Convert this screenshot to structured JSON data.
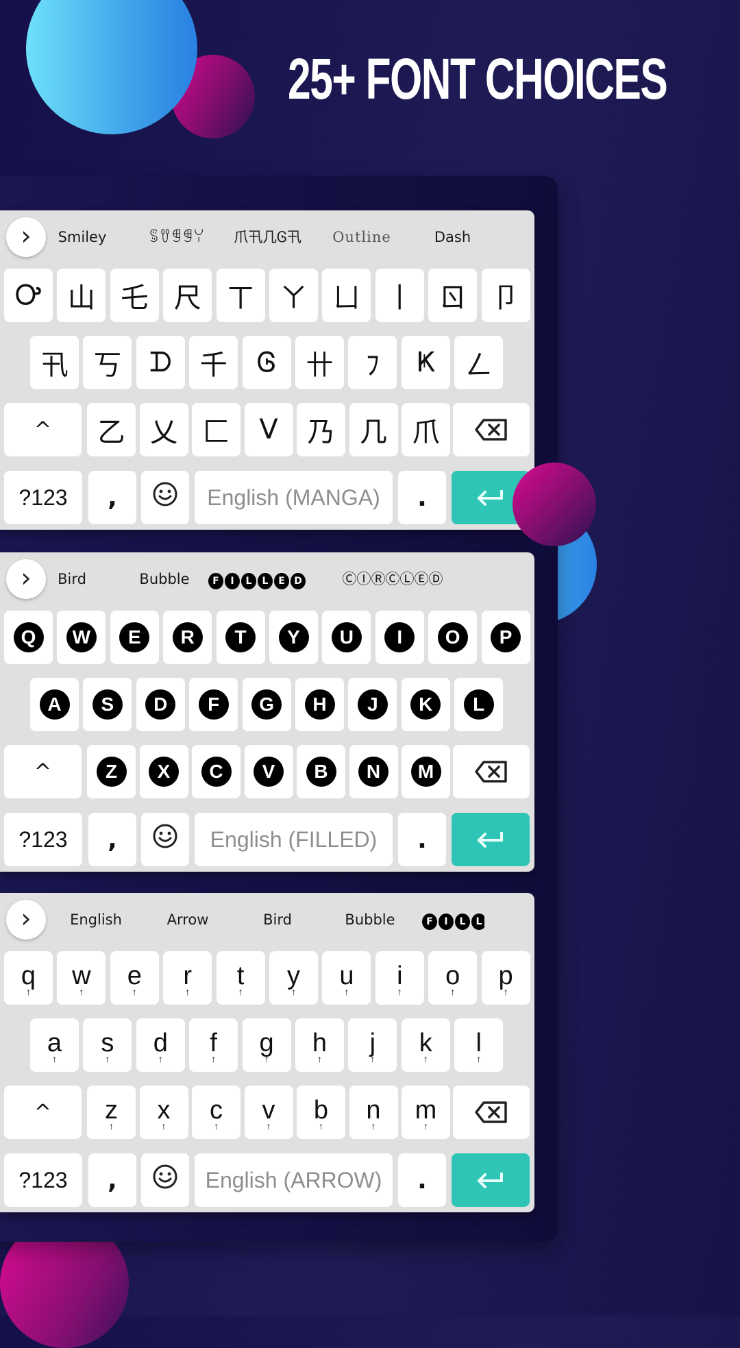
{
  "title": "25+ FONT CHOICES",
  "colors": {
    "background": "#15104a",
    "keyboard_bg": "#e0e0e0",
    "key_bg": "#ffffff",
    "enter_key": "#2ec4b6",
    "active_tab_underline": "#f0a030",
    "space_text": "#8e8e8e"
  },
  "keyboards": [
    {
      "toolbar": {
        "expand_icon": "chevron-right",
        "tabs": [
          {
            "label": "Smiley",
            "active": false
          },
          {
            "label": "ꌚꀎꁅꁅꌩ",
            "active": false
          },
          {
            "label": "爪卂几Ꮆ卂",
            "active": true
          },
          {
            "label": "Outline",
            "active": false
          },
          {
            "label": "Dash",
            "active": false
          }
        ]
      },
      "rows": [
        [
          "Ꭴ",
          "山",
          "乇",
          "尺",
          "ㄒ",
          "ㄚ",
          "ㄩ",
          "丨",
          "ㄖ",
          "卩"
        ],
        [
          "卂",
          "丂",
          "ᗪ",
          "千",
          "Ꮆ",
          "卄",
          "ﾌ",
          "Ҝ",
          "ㄥ"
        ],
        [
          "乙",
          "乂",
          "匚",
          "ᐯ",
          "乃",
          "几",
          "爪"
        ]
      ],
      "bottom": {
        "symbols": "?123",
        "comma": ",",
        "emoji_icon": "smiley",
        "space": "English (MANGA)",
        "period": ".",
        "enter_icon": "enter-arrow"
      }
    },
    {
      "toolbar": {
        "expand_icon": "chevron-right",
        "tabs": [
          {
            "label": "Bird",
            "active": false
          },
          {
            "label": "Bubble",
            "active": false
          },
          {
            "label": "FILLED",
            "active": true
          },
          {
            "label": "ⒸⒾⓇⒸⓁⒺⒹ",
            "active": false
          }
        ]
      },
      "rows": [
        [
          "Q",
          "W",
          "E",
          "R",
          "T",
          "Y",
          "U",
          "I",
          "O",
          "P"
        ],
        [
          "A",
          "S",
          "D",
          "F",
          "G",
          "H",
          "J",
          "K",
          "L"
        ],
        [
          "Z",
          "X",
          "C",
          "V",
          "B",
          "N",
          "M"
        ]
      ],
      "bottom": {
        "symbols": "?123",
        "comma": ",",
        "emoji_icon": "smiley",
        "space": "English (FILLED)",
        "period": ".",
        "enter_icon": "enter-arrow"
      }
    },
    {
      "toolbar": {
        "expand_icon": "chevron-right",
        "tabs": [
          {
            "label": "English",
            "active": false
          },
          {
            "label": "Arrow",
            "active": true
          },
          {
            "label": "Bird",
            "active": false
          },
          {
            "label": "Bubble",
            "active": false
          },
          {
            "label": "FILL",
            "active": false
          }
        ]
      },
      "rows": [
        [
          "q",
          "w",
          "e",
          "r",
          "t",
          "y",
          "u",
          "i",
          "o",
          "p"
        ],
        [
          "a",
          "s",
          "d",
          "f",
          "g",
          "h",
          "j",
          "k",
          "l"
        ],
        [
          "z",
          "x",
          "c",
          "v",
          "b",
          "n",
          "m"
        ]
      ],
      "arrow_mark": "↑",
      "bottom": {
        "symbols": "?123",
        "comma": ",",
        "emoji_icon": "smiley",
        "space": "English (ARROW)",
        "period": ".",
        "enter_icon": "enter-arrow"
      }
    }
  ]
}
